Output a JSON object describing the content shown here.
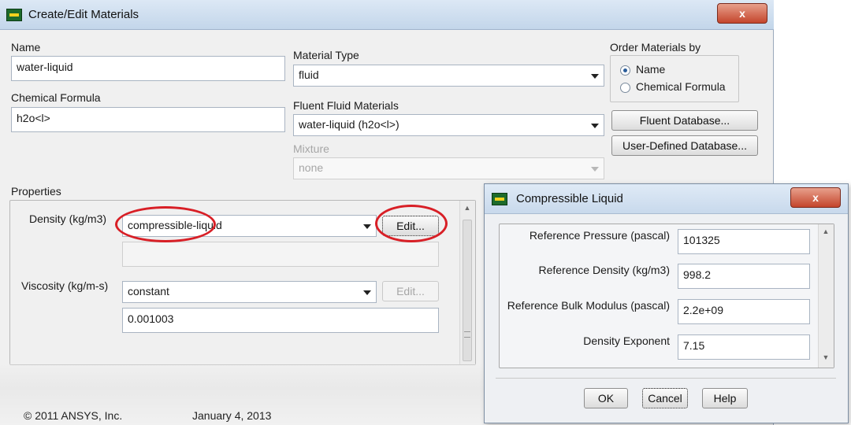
{
  "main_window": {
    "title": "Create/Edit Materials",
    "close_label": "x",
    "name": {
      "label": "Name",
      "value": "water-liquid"
    },
    "chemical_formula": {
      "label": "Chemical Formula",
      "value": "h2o<l>"
    },
    "material_type": {
      "label": "Material Type",
      "selected": "fluid"
    },
    "fluent_fluid_materials": {
      "label": "Fluent Fluid Materials",
      "selected": "water-liquid (h2o<l>)"
    },
    "mixture": {
      "label": "Mixture",
      "selected": "none"
    },
    "order_by": {
      "label": "Order Materials by",
      "options": [
        "Name",
        "Chemical Formula"
      ],
      "selected": "Name"
    },
    "buttons": {
      "fluent_database": "Fluent Database...",
      "user_defined_database": "User-Defined Database..."
    },
    "properties": {
      "label": "Properties",
      "density": {
        "label": "Density (kg/m3)",
        "method": "compressible-liquid",
        "edit_label": "Edit..."
      },
      "viscosity": {
        "label": "Viscosity (kg/m-s)",
        "method": "constant",
        "edit_label": "Edit...",
        "value": "0.001003"
      }
    }
  },
  "dialog": {
    "title": "Compressible Liquid",
    "close_label": "x",
    "params": [
      {
        "label": "Reference Pressure (pascal)",
        "value": "101325"
      },
      {
        "label": "Reference Density (kg/m3)",
        "value": "998.2"
      },
      {
        "label": "Reference Bulk Modulus (pascal)",
        "value": "2.2e+09"
      },
      {
        "label": "Density Exponent",
        "value": "7.15"
      }
    ],
    "buttons": {
      "ok": "OK",
      "cancel": "Cancel",
      "help": "Help"
    }
  },
  "footer": {
    "copyright": "© 2011 ANSYS, Inc.",
    "date": "January 4, 2013"
  },
  "colors": {
    "highlight": "#d81f26",
    "titlebar": "#c3d6ea",
    "close": "#c4452c"
  }
}
